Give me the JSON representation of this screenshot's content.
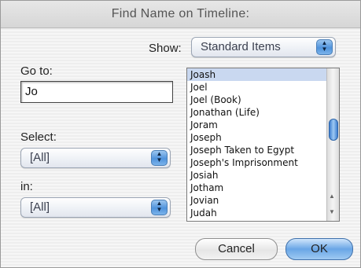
{
  "window": {
    "title": "Find Name on Timeline:"
  },
  "show": {
    "label": "Show:",
    "value": "Standard Items"
  },
  "goto": {
    "label": "Go to:",
    "value": "Jo"
  },
  "select": {
    "label": "Select:",
    "value": "[All]"
  },
  "in": {
    "label": "in:",
    "value": "[All]"
  },
  "list": {
    "items": [
      "Joash",
      "Joel",
      "Joel (Book)",
      "Jonathan (Life)",
      "Joram",
      "Joseph",
      "Joseph Taken to Egypt",
      "Joseph's Imprisonment",
      "Josiah",
      "Jotham",
      "Jovian",
      "Judah"
    ],
    "selected_index": 0
  },
  "buttons": {
    "cancel": "Cancel",
    "ok": "OK"
  }
}
